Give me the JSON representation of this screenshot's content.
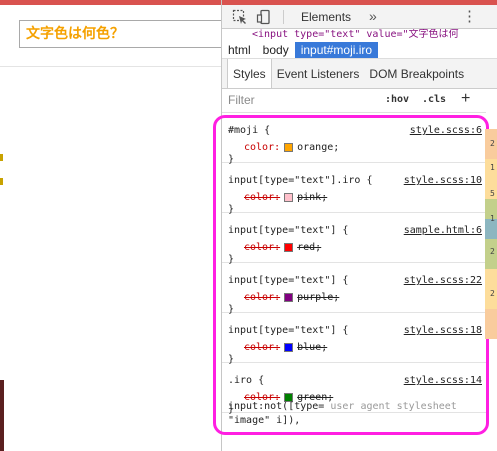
{
  "page": {
    "input_value": "文字色は何色？"
  },
  "devtools": {
    "toolbar": {
      "elements_tab": "Elements",
      "more": "»",
      "close": "⋮"
    },
    "source_line": "<input type=\"text\" value=\"文字色は何",
    "breadcrumbs": [
      "html",
      "body",
      "input#moji.iro"
    ],
    "subtabs": [
      "Styles",
      "Event Listeners",
      "DOM Breakpoints"
    ],
    "filter": {
      "placeholder": "Filter",
      "hov": ":hov",
      "cls": ".cls",
      "add": "+"
    },
    "rules": [
      {
        "selector": "#moji {",
        "source": "style.scss:6",
        "property": "color:",
        "value": "orange;",
        "swatch": "#ffa500",
        "struck": false
      },
      {
        "selector": "input[type=\"text\"].iro {",
        "source": "style.scss:10",
        "property": "color:",
        "value": "pink;",
        "swatch": "#ffc0cb",
        "struck": true
      },
      {
        "selector": "input[type=\"text\"] {",
        "source": "sample.html:6",
        "property": "color:",
        "value": "red;",
        "swatch": "#ff0000",
        "struck": true
      },
      {
        "selector": "input[type=\"text\"] {",
        "source": "style.scss:22",
        "property": "color:",
        "value": "purple;",
        "swatch": "#800080",
        "struck": true
      },
      {
        "selector": "input[type=\"text\"] {",
        "source": "style.scss:18",
        "property": "color:",
        "value": "blue;",
        "swatch": "#0000ff",
        "struck": true
      },
      {
        "selector": ".iro {",
        "source": "style.scss:14",
        "property": "color:",
        "value": "green;",
        "swatch": "#008000",
        "struck": true
      }
    ],
    "rule_close": "}",
    "last_rule": {
      "line1": "input:not([type=",
      "ua": "user agent stylesheet",
      "line2": "\"image\" i]),"
    },
    "metrics_digits": [
      "2",
      "1",
      "5",
      "1",
      "2",
      "2"
    ]
  },
  "colors": {
    "highlight": "#ff1fe2",
    "input_text": "#f5a100",
    "active_crumb": "#3879d9"
  }
}
